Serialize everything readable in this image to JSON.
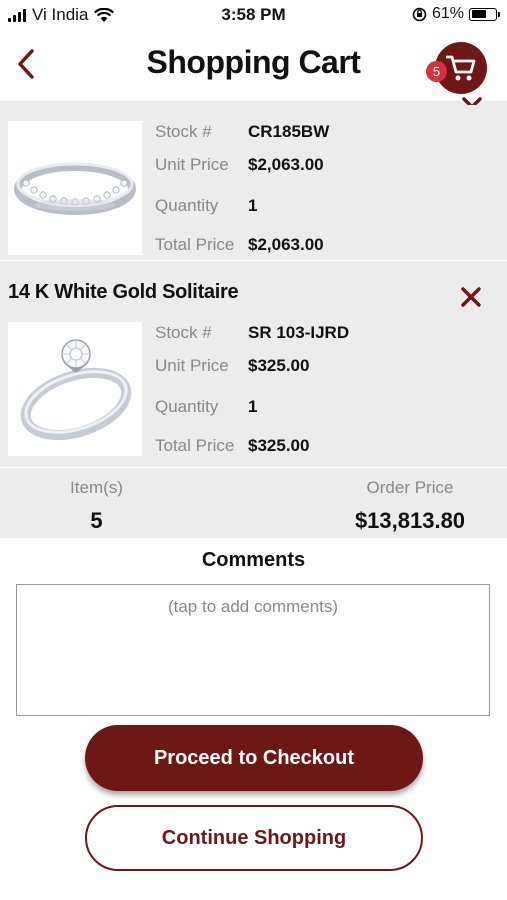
{
  "status_bar": {
    "carrier": "Vi India",
    "time": "3:58 PM",
    "battery": "61%",
    "battery_level": 0.61
  },
  "header": {
    "title": "Shopping Cart",
    "cart_count": "5",
    "accent_color": "#6e1717",
    "badge_color": "#d8323c"
  },
  "labels": {
    "stock": "Stock #",
    "unit_price": "Unit Price",
    "quantity": "Quantity",
    "total_price": "Total Price"
  },
  "items": [
    {
      "name": "",
      "stock": "CR185BW",
      "unit_price": "$2,063.00",
      "quantity": "1",
      "total_price": "$2,063.00",
      "image_icon": "diamond-band-ring"
    },
    {
      "name": "14 K White Gold Solitaire",
      "stock": "SR 103-IJRD",
      "unit_price": "$325.00",
      "quantity": "1",
      "total_price": "$325.00",
      "image_icon": "solitaire-ring"
    }
  ],
  "summary": {
    "items_label": "Item(s)",
    "items_count": "5",
    "order_price_label": "Order Price",
    "order_price": "$13,813.80"
  },
  "comments": {
    "title": "Comments",
    "placeholder": "(tap to add comments)"
  },
  "buttons": {
    "checkout": "Proceed to Checkout",
    "continue": "Continue Shopping"
  }
}
